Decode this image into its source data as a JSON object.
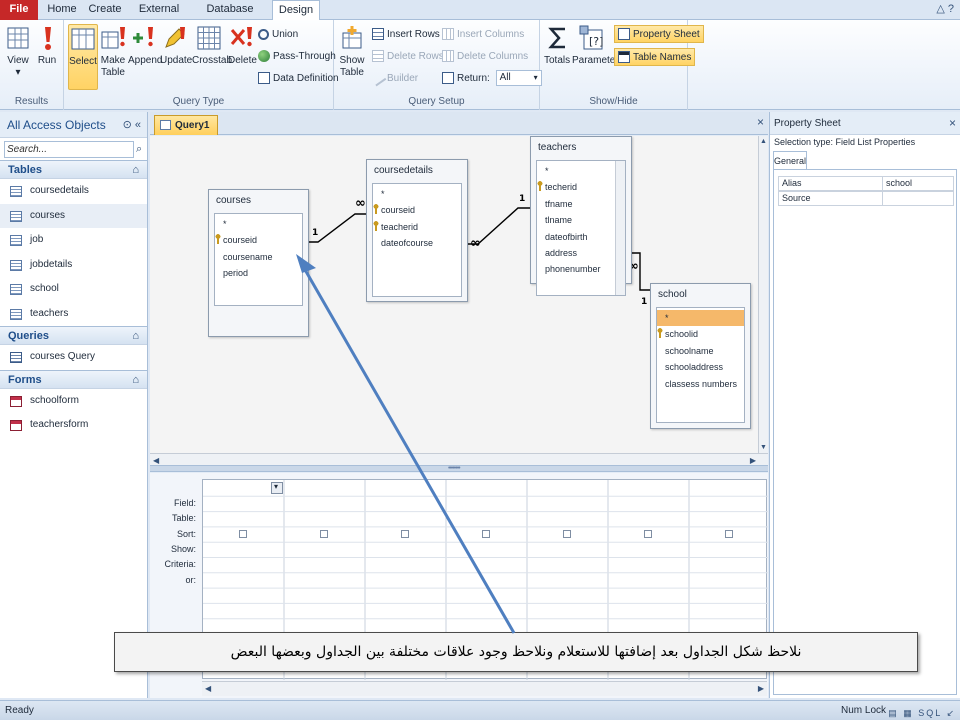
{
  "ribbon": {
    "tabs": [
      {
        "id": "file",
        "label": "File"
      },
      {
        "id": "home",
        "label": "Home"
      },
      {
        "id": "create",
        "label": "Create"
      },
      {
        "id": "external",
        "label": "External Data"
      },
      {
        "id": "dbtools",
        "label": "Database Tools"
      },
      {
        "id": "design",
        "label": "Design"
      }
    ],
    "window_controls": "△ ?",
    "groups": {
      "results": {
        "label": "Results",
        "view": "View",
        "view_arrow": "▾",
        "run": "Run"
      },
      "query_type": {
        "label": "Query Type",
        "select": "Select",
        "make_table": [
          "Make",
          "Table"
        ],
        "append": "Append",
        "update": "Update",
        "crosstab": "Crosstab",
        "delete": "Delete",
        "union": "Union",
        "pass_through": "Pass-Through",
        "data_definition": "Data Definition"
      },
      "query_setup": {
        "label": "Query Setup",
        "show_table": [
          "Show",
          "Table"
        ],
        "insert_rows": "Insert Rows",
        "delete_rows": "Delete Rows",
        "builder": "Builder",
        "insert_columns": "Insert Columns",
        "delete_columns": "Delete Columns",
        "return_label": "Return:",
        "return_value": "All"
      },
      "show_hide": {
        "label": "Show/Hide",
        "totals": "Totals",
        "parameters": "Parameters",
        "property_sheet": "Property Sheet",
        "table_names": "Table Names"
      }
    }
  },
  "nav": {
    "title": "All Access Objects",
    "title_controls": "⊙ «",
    "search_placeholder": "Search...",
    "search_icon": "⌕",
    "collapse_glyph": "⌂",
    "sections": [
      {
        "label": "Tables",
        "items": [
          "coursedetails",
          "courses",
          "job",
          "jobdetails",
          "school",
          "teachers"
        ]
      },
      {
        "label": "Queries",
        "items": [
          "courses Query"
        ]
      },
      {
        "label": "Forms",
        "items": [
          "schoolform",
          "teachersform"
        ]
      }
    ]
  },
  "doc": {
    "tab_label": "Query1",
    "close": "×",
    "tables": [
      {
        "title": "courses",
        "fields": [
          {
            "name": "*"
          },
          {
            "name": "courseid",
            "key": true
          },
          {
            "name": "coursename"
          },
          {
            "name": "period"
          }
        ]
      },
      {
        "title": "coursedetails",
        "fields": [
          {
            "name": "*"
          },
          {
            "name": "courseid",
            "key": true
          },
          {
            "name": "teacherid",
            "key": true
          },
          {
            "name": "dateofcourse"
          }
        ]
      },
      {
        "title": "teachers",
        "fields": [
          {
            "name": "*"
          },
          {
            "name": "techerid",
            "key": true
          },
          {
            "name": "tfname"
          },
          {
            "name": "tlname"
          },
          {
            "name": "dateofbirth"
          },
          {
            "name": "address"
          },
          {
            "name": "phonenumber"
          }
        ]
      },
      {
        "title": "school",
        "fields": [
          {
            "name": "*"
          },
          {
            "name": "schoolid",
            "key": true
          },
          {
            "name": "schoolname"
          },
          {
            "name": "schooladdress"
          },
          {
            "name": "classess numbers"
          }
        ]
      }
    ],
    "relationships": [
      {
        "from": "courses",
        "to": "coursedetails",
        "from_label": "1",
        "to_label": "∞"
      },
      {
        "from": "coursedetails",
        "to": "teachers",
        "from_label": "∞",
        "to_label": "1"
      },
      {
        "from": "teachers",
        "to": "school",
        "from_label": "∞",
        "to_label": "1"
      }
    ],
    "grid": {
      "row_labels": [
        "Field:",
        "Table:",
        "Sort:",
        "Show:",
        "Criteria:",
        "or:"
      ],
      "columns": 7
    }
  },
  "properties": {
    "title": "Property Sheet",
    "close": "×",
    "selection_type": "Selection type:  Field List Properties",
    "tab": "General",
    "rows": [
      {
        "name": "Alias",
        "value": "school"
      },
      {
        "name": "Source",
        "value": ""
      }
    ]
  },
  "status": {
    "left": "Ready",
    "right": "Num Lock",
    "views": "▤ ▦ SQL ↙"
  },
  "annotation": {
    "caption": "نلاحظ شكل الجداول بعد إضافتها للاستعلام ونلاحظ وجود علاقات مختلفة بين الجداول وبعضها البعض",
    "arrow_color": "#4f7fc0"
  }
}
